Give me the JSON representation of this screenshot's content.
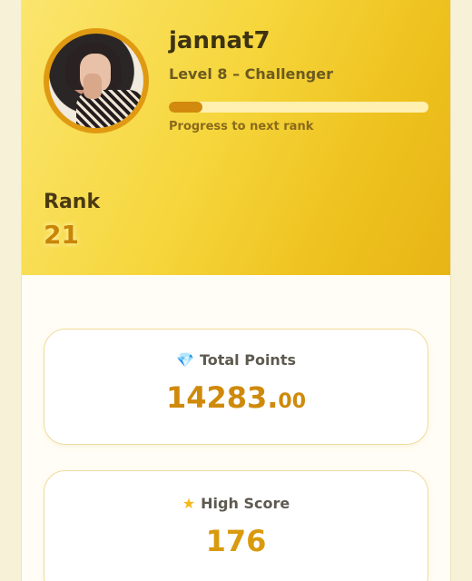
{
  "profile": {
    "username": "jannat7",
    "level_text": "Level 8 – Challenger",
    "progress_label": "Progress to next rank",
    "progress_fraction": 0.13
  },
  "rank": {
    "label": "Rank",
    "value": "21"
  },
  "stats": {
    "total_points": {
      "icon": "gem-icon",
      "label": "Total Points",
      "value_int": "14283.",
      "value_dec": "00"
    },
    "high_score": {
      "icon": "star-icon",
      "label": "High Score",
      "value": "176"
    }
  },
  "colors": {
    "accent": "#d18a0d",
    "hero_start": "#fbe56e",
    "hero_end": "#e7b515"
  }
}
